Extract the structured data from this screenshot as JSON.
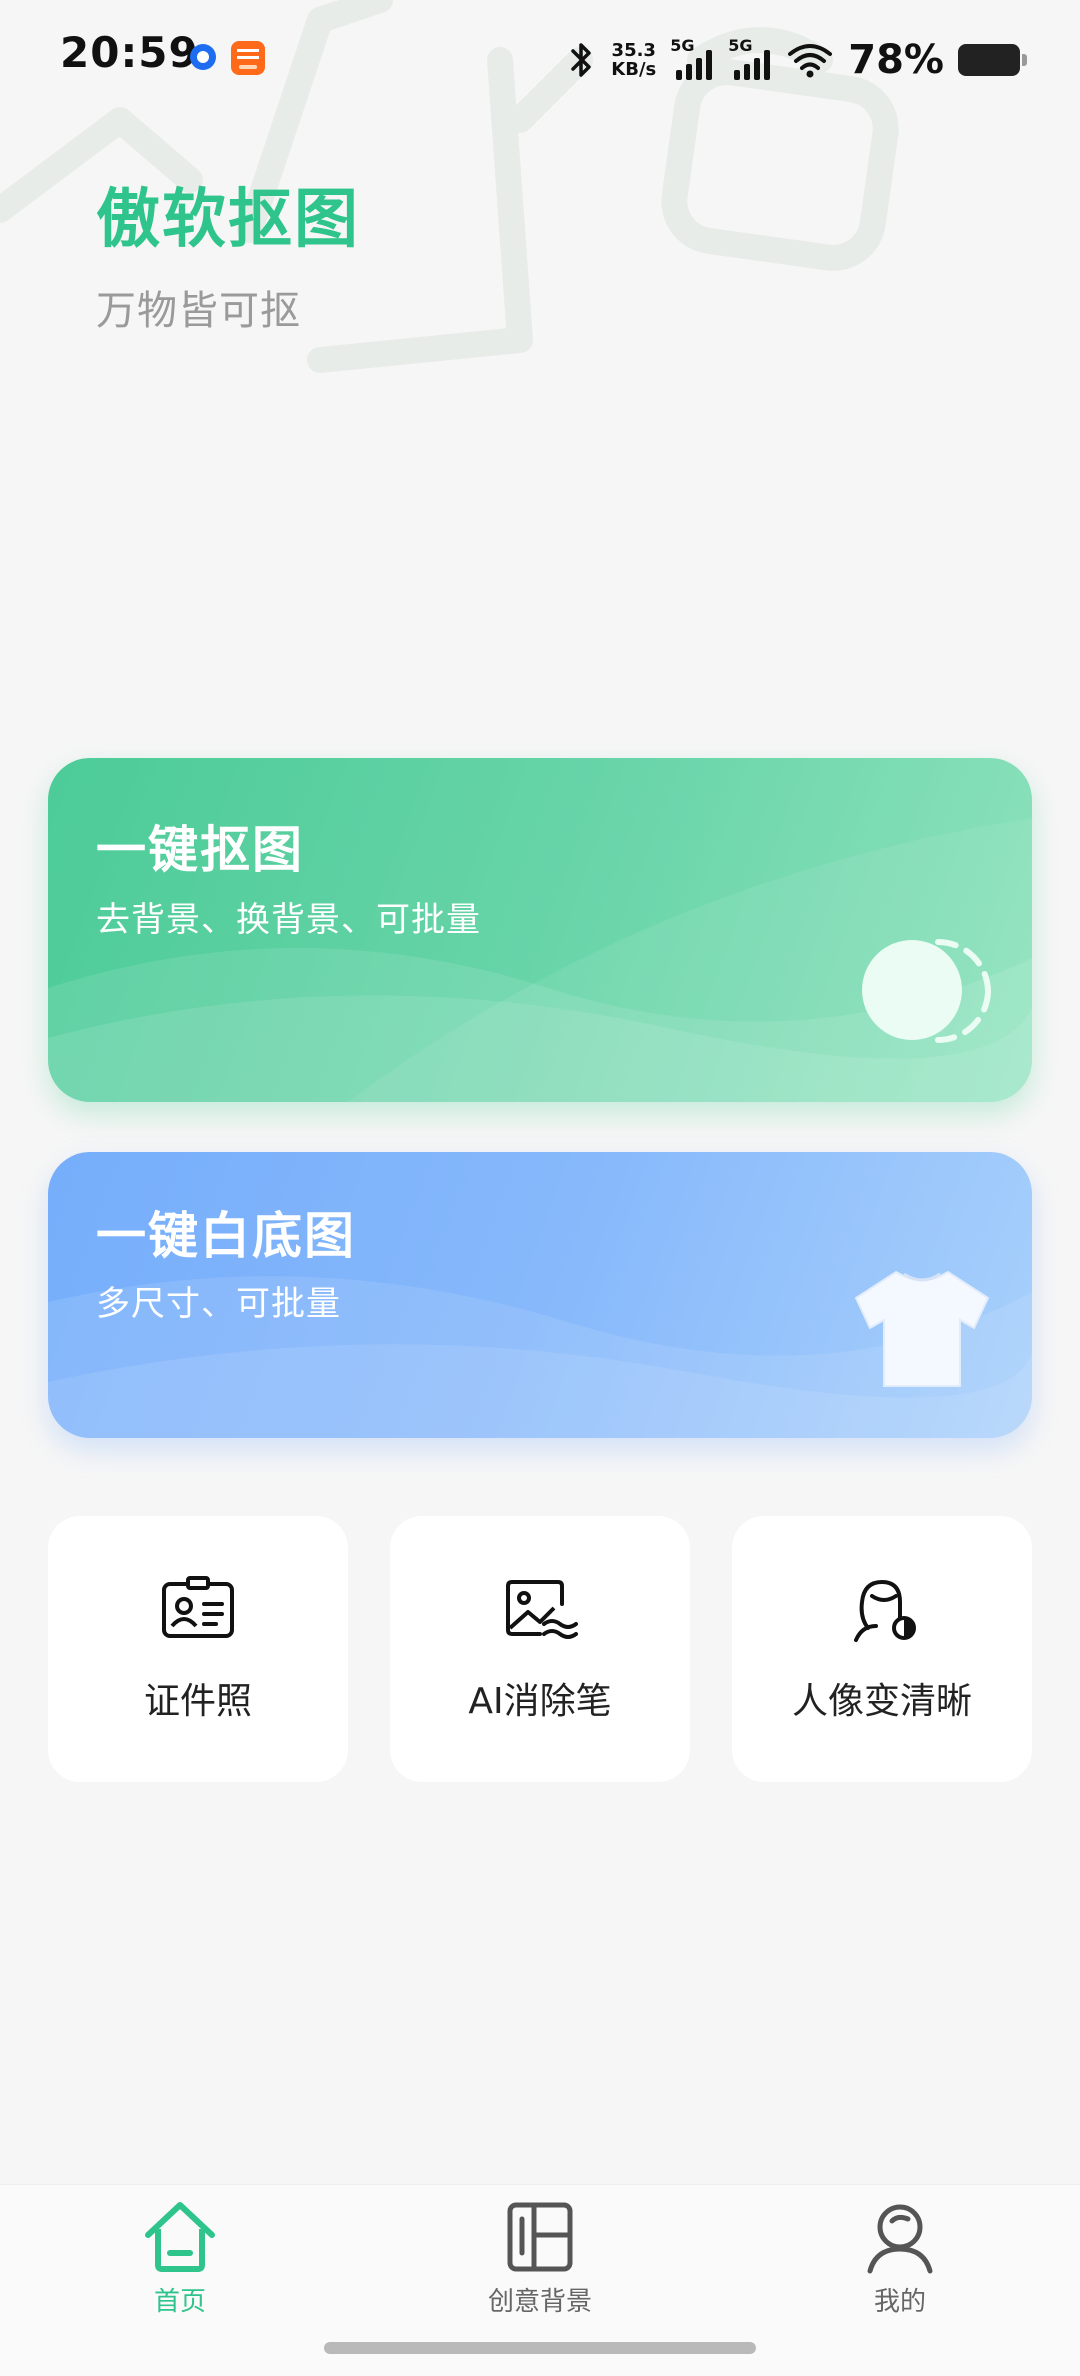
{
  "status_bar": {
    "time": "20:59",
    "net_speed_value": "35.3",
    "net_speed_unit": "KB/s",
    "signal_1_label": "5G",
    "signal_2_label": "5G",
    "battery_percent": "78%",
    "icons": [
      "app-notification-icon",
      "taobao-flash-icon",
      "bluetooth-icon",
      "signal-icon",
      "wifi-icon",
      "battery-icon"
    ]
  },
  "header": {
    "title": "傲软抠图",
    "subtitle": "万物皆可抠"
  },
  "cards": {
    "cutout": {
      "title": "一键抠图",
      "desc": "去背景、换背景、可批量",
      "icon": "toggle-graphic"
    },
    "white_bg": {
      "title": "一键白底图",
      "desc": "多尺寸、可批量",
      "icon": "tshirt-icon"
    }
  },
  "tools": [
    {
      "label": "证件照",
      "icon": "id-card-icon"
    },
    {
      "label": "AI消除笔",
      "icon": "image-eraser-icon"
    },
    {
      "label": "人像变清晰",
      "icon": "portrait-enhance-icon"
    }
  ],
  "nav": {
    "home": "首页",
    "creative": "创意背景",
    "mine": "我的",
    "active": "home",
    "active_color": "#2fc48c"
  },
  "colors": {
    "brand_green": "#2fc48c",
    "card_green": "#4ccb98",
    "card_blue": "#76aefb"
  }
}
